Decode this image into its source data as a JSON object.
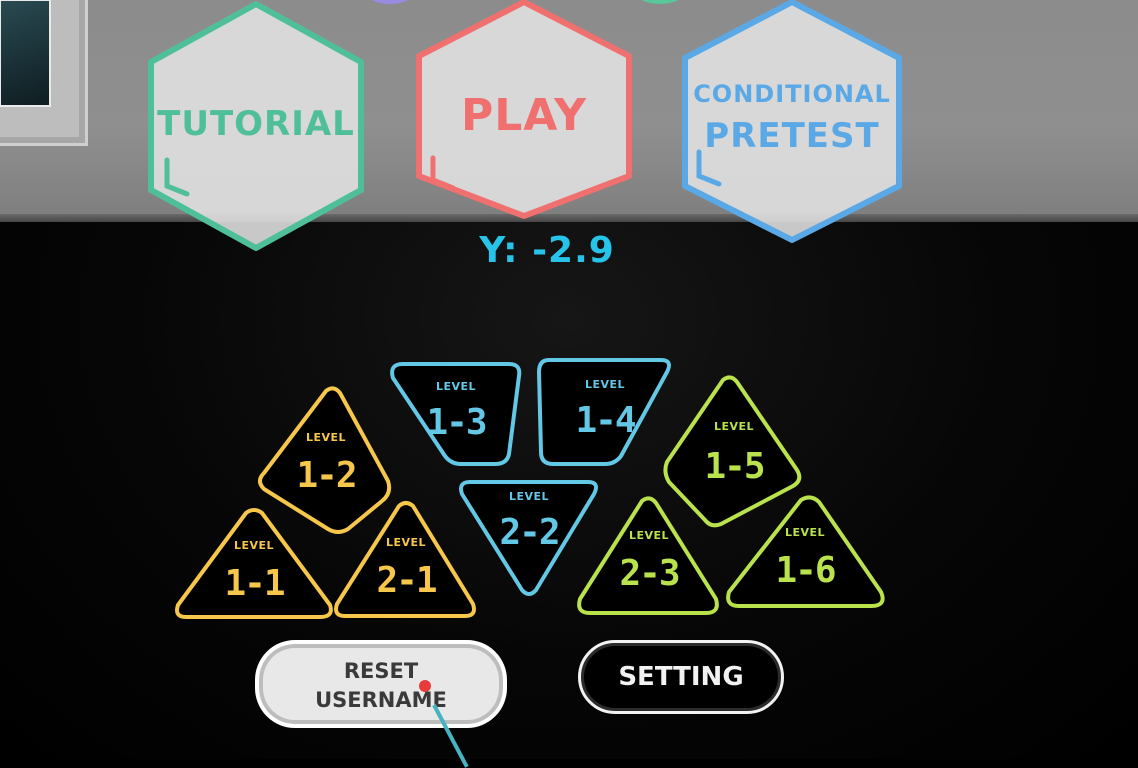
{
  "menu": {
    "tutorial_label": "TUTORIAL",
    "play_label": "PLAY",
    "pretest_label_line1": "CONDITIONAL",
    "pretest_label_line2": "PRETEST"
  },
  "readout": {
    "text": "Y: -2.9"
  },
  "levels": {
    "level_word": "LEVEL",
    "l1_1": "1-1",
    "l1_2": "1-2",
    "l2_1": "2-1",
    "l1_3": "1-3",
    "l1_4": "1-4",
    "l2_2": "2-2",
    "l1_5": "1-5",
    "l2_3": "2-3",
    "l1_6": "1-6"
  },
  "buttons": {
    "reset_line1": "RESET",
    "reset_line2": "USERNAME",
    "setting": "SETTING"
  },
  "colors": {
    "tutorial": "#4fbf9a",
    "play": "#f07070",
    "pretest": "#5aa9e6",
    "yellow": "#f6c74a",
    "blue": "#63c8e6",
    "green": "#b9e24c",
    "readout": "#27c4ea"
  }
}
